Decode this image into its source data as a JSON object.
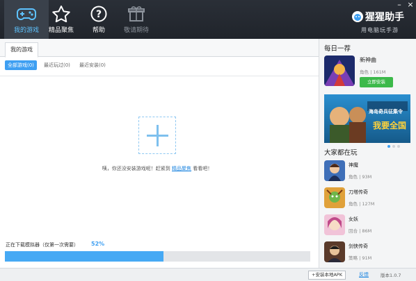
{
  "nav": {
    "items": [
      {
        "label": "我的游戏",
        "icon": "gamepad-icon"
      },
      {
        "label": "精品聚焦",
        "icon": "star-icon"
      },
      {
        "label": "帮助",
        "icon": "help-icon"
      },
      {
        "label": "敬请期待",
        "icon": "gift-icon"
      }
    ],
    "active_color": "#5ec3ff"
  },
  "window": {
    "minimize": "–",
    "close": "×"
  },
  "brand": {
    "name": "猩猩助手",
    "tagline": "用电脑玩手游"
  },
  "left": {
    "tab": "我的游戏",
    "filters": [
      "全部游戏(0)",
      "最近玩过(0)",
      "最近安装(0)"
    ],
    "empty_prefix": "咦，你还没安装游戏呢！赶紧到",
    "empty_link": "精品聚焦",
    "empty_suffix": "看看吧！",
    "download_label": "正在下载模拟器（仅第一次需要）",
    "download_percent_text": "52%",
    "download_progress": 0.52
  },
  "right": {
    "daily_title": "每日一荐",
    "featured": {
      "name": "新神曲",
      "genre": "角色",
      "size": "161M",
      "install": "立即安装"
    },
    "banner": {
      "line1": "海岛奇兵征集令",
      "line2": "我要全国"
    },
    "popular_title": "大家都在玩",
    "games": [
      {
        "name": "神魔",
        "genre": "角色",
        "size": "93M"
      },
      {
        "name": "刀塔传奇",
        "genre": "角色",
        "size": "127M"
      },
      {
        "name": "女妖",
        "genre": "回合",
        "size": "86M"
      },
      {
        "name": "剑侠传奇",
        "genre": "策略",
        "size": "91M"
      }
    ]
  },
  "bottom": {
    "local_apk": "+安装本地APK",
    "feedback": "反馈",
    "version": "版本1.0.7"
  },
  "colors": {
    "accent": "#3e9ff2",
    "install_green": "#3cb94a",
    "topbar": "#23272e"
  }
}
